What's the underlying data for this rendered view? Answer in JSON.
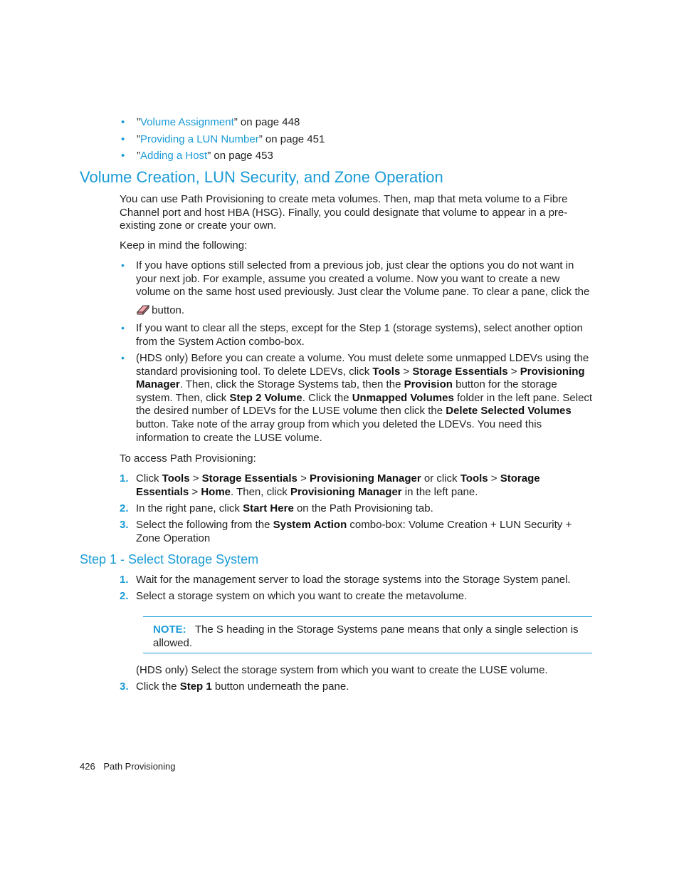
{
  "xrefs": [
    {
      "open": "”",
      "link": "Volume Assignment",
      "close": "” on page 448"
    },
    {
      "open": "”",
      "link": "Providing a LUN Number",
      "close": "” on page 451"
    },
    {
      "open": "”",
      "link": "Adding a Host",
      "close": "” on page 453"
    }
  ],
  "section_title": "Volume Creation, LUN Security, and Zone Operation",
  "intro": "You can use Path Provisioning to create meta volumes. Then, map that meta volume to a Fibre Channel port and host HBA (HSG). Finally, you could designate that volume to appear in a pre-existing zone or create your own.",
  "keep_in_mind": "Keep in mind the following:",
  "bullets": {
    "b1": "If you have options still selected from a previous job, just clear the options you do not want in your next job. For example, assume you created a volume. Now you want to create a new volume on the same host used previously. Just clear the Volume pane. To clear a pane, click the",
    "b1_tail": "button.",
    "b1_icon": "eraser-icon",
    "b2": "If you want to clear all the steps, except for the Step 1 (storage systems), select another option from the System Action combo-box.",
    "b3": {
      "t1": "(HDS only) Before you can create a volume. You must delete some unmapped LDEVs using the standard provisioning tool. To delete LDEVs, click ",
      "k1": "Tools",
      "s1": " > ",
      "k2": "Storage Essentials",
      "s2": " > ",
      "k3": "Provisioning Manager",
      "t2": ". Then, click the Storage Systems tab, then the ",
      "k4": "Provision",
      "t3": " button for the storage system. Then, click ",
      "k5": "Step 2 Volume",
      "t4": ". Click the ",
      "k6": "Unmapped Volumes",
      "t5": " folder in the left pane. Select the desired number of LDEVs for the LUSE volume then click the ",
      "k7": "Delete Selected Volumes",
      "t6": " button. Take note of the array group from which you deleted the LDEVs. You need this information to create the LUSE volume."
    }
  },
  "access_intro": "To access Path Provisioning:",
  "access_steps": [
    {
      "num": "1.",
      "t1": "Click ",
      "k1": "Tools",
      "s1": " > ",
      "k2": "Storage Essentials",
      "s2": " > ",
      "k3": "Provisioning Manager",
      "t2": " or click ",
      "k4": "Tools",
      "s3": " > ",
      "k5": "Storage Essentials",
      "s4": " > ",
      "k6": "Home",
      "t3": ". Then, click ",
      "k7": "Provisioning Manager",
      "t4": " in the left pane."
    },
    {
      "num": "2.",
      "t1": "In the right pane, click ",
      "k1": "Start Here",
      "t2": " on the Path Provisioning tab."
    },
    {
      "num": "3.",
      "t1": "Select the following from the ",
      "k1": "System Action",
      "t2": " combo-box: Volume Creation + LUN Security + Zone Operation"
    }
  ],
  "step1_title": "Step 1 - Select Storage System",
  "step1_items": [
    {
      "num": "1.",
      "text": "Wait for the management server to load the storage systems into the Storage System panel."
    },
    {
      "num": "2.",
      "text": "Select a storage system on which you want to create the metavolume."
    }
  ],
  "note": {
    "label": "NOTE:",
    "text": "The S heading in the Storage Systems pane means that only a single selection is allowed."
  },
  "hds_note": "(HDS only) Select the storage system from which you want to create the LUSE volume.",
  "step1_item3": {
    "num": "3.",
    "t1": "Click the ",
    "k1": "Step 1",
    "t2": " button underneath the pane."
  },
  "footer": {
    "page": "426",
    "title": "Path Provisioning"
  }
}
